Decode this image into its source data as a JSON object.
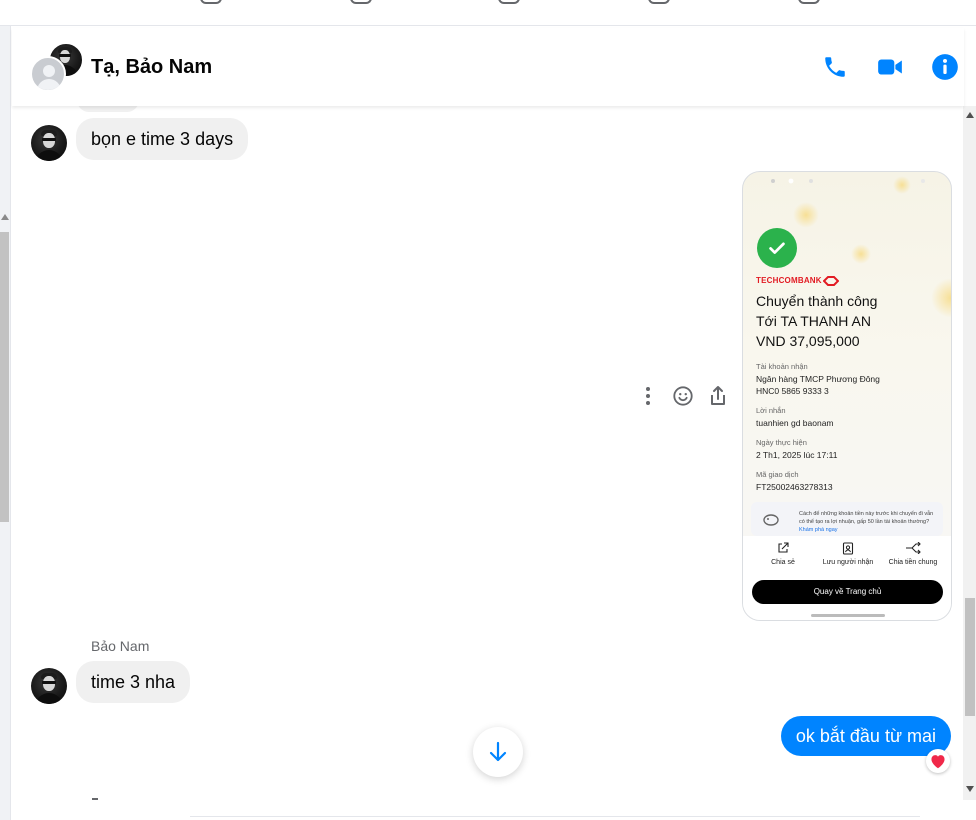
{
  "header": {
    "title": "Tạ, Bảo Nam"
  },
  "messages": {
    "m1_text": "bọn e time 3 days",
    "sender_name": "Bảo Nam",
    "m2_text": "time 3 nha",
    "m3_text": "ok bắt đầu từ mai"
  },
  "attachment": {
    "bank_name": "TECHCOMBANK",
    "title": "Chuyển thành công",
    "recipient": "Tới TA THANH AN",
    "amount": "VND 37,095,000",
    "account_label": "Tài khoản nhận",
    "account_bank": "Ngân hàng TMCP Phương Đông",
    "account_number": "HNC0 5865 9333 3",
    "message_label": "Lời nhắn",
    "message_value": "tuanhien gd baonam",
    "date_label": "Ngày thực hiện",
    "date_value": "2 Th1, 2025 lúc 17:11",
    "txn_label": "Mã giao dịch",
    "txn_value": "FT25002463278313",
    "notice_text": "Cách để những khoản tiền này trước khi chuyển đi vẫn có thể tạo ra lợi nhuận, gấp 50 lần tài khoản thường?",
    "notice_link": "Khám phá ngay",
    "share_label": "Chia sẻ",
    "save_label": "Lưu người nhận",
    "split_label": "Chia tiền chung",
    "home_label": "Quay về Trang chủ"
  },
  "colors": {
    "accent": "#0084ff",
    "incoming_bubble": "#f0f0f0",
    "success": "#2bb24c",
    "bank_red": "#e21b23"
  },
  "icons": {
    "call": "phone-icon",
    "video": "video-camera-icon",
    "info": "info-icon",
    "more": "more-vertical-icon",
    "react": "smiley-icon",
    "share": "share-icon",
    "scroll": "arrow-down-icon",
    "reaction": "heart-icon"
  }
}
